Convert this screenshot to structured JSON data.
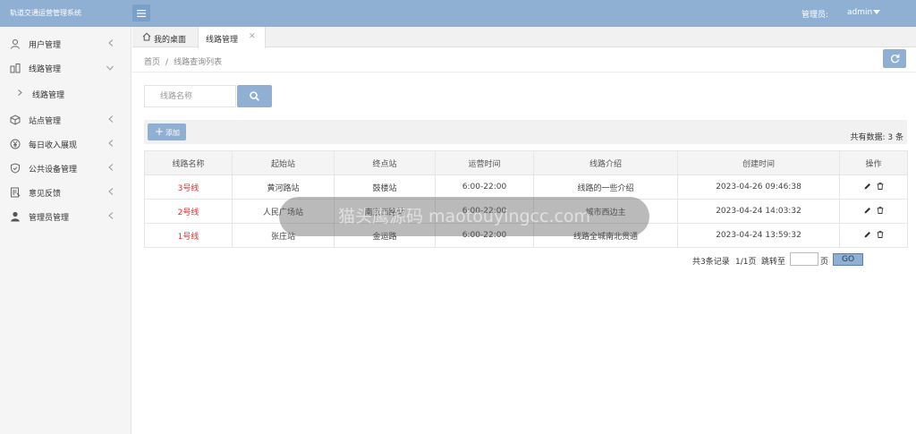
{
  "header": {
    "app_title": "轨道交通运营管理系统",
    "admin_label": "管理员:",
    "admin_name": "admin"
  },
  "sidebar": {
    "items": [
      {
        "label": "用户管理",
        "icon": "user-icon"
      },
      {
        "label": "线路管理",
        "icon": "route-icon",
        "expanded": true
      },
      {
        "label": "站点管理",
        "icon": "cube-icon"
      },
      {
        "label": "每日收入展现",
        "icon": "yen-icon"
      },
      {
        "label": "公共设备管理",
        "icon": "shield-icon"
      },
      {
        "label": "意见反馈",
        "icon": "feedback-icon"
      },
      {
        "label": "管理员管理",
        "icon": "admin-user-icon"
      }
    ],
    "sub_item": {
      "label": "线路管理"
    }
  },
  "tabs": [
    {
      "label": "我的桌面",
      "icon": "home-icon"
    },
    {
      "label": "线路管理",
      "active": true
    }
  ],
  "breadcrumb": {
    "home": "首页",
    "separator": "/",
    "current": "线路查询列表"
  },
  "search": {
    "placeholder": "线路名称",
    "button_icon": "search-icon"
  },
  "toolbar": {
    "add_icon": "plus-icon",
    "add_label": "添加",
    "total_text": "共有数据: 3 条"
  },
  "table": {
    "columns": [
      "线路名称",
      "起始站",
      "终点站",
      "运营时间",
      "线路介绍",
      "创建时间",
      "操作"
    ],
    "rows": [
      {
        "name": "3号线",
        "start": "黄河路站",
        "end": "鼓楼站",
        "hours": "6:00-22:00",
        "intro": "线路的一些介绍",
        "created": "2023-04-26 09:46:38"
      },
      {
        "name": "2号线",
        "start": "人民广场站",
        "end": "南京西路站",
        "hours": "6:00-22:00",
        "intro": "城市西边主",
        "created": "2023-04-24 14:03:32"
      },
      {
        "name": "1号线",
        "start": "张庄站",
        "end": "金运路",
        "hours": "6:00-22:00",
        "intro": "线路全城南北贯通",
        "created": "2023-04-24 13:59:32"
      }
    ],
    "line_name_color": "#e52e2e"
  },
  "pagination": {
    "records": "共3条记录",
    "pages": "1/1页",
    "jump_label": "跳转至",
    "jump_value": "",
    "suffix": "页",
    "go_label": "GO"
  },
  "watermark": {
    "text": "猫头鹰源码 maotouyingcc.com"
  },
  "colors": {
    "accent": "#8fb0d3",
    "line_name": "#e52e2e",
    "sidebar_bg": "#f5f5f5"
  }
}
